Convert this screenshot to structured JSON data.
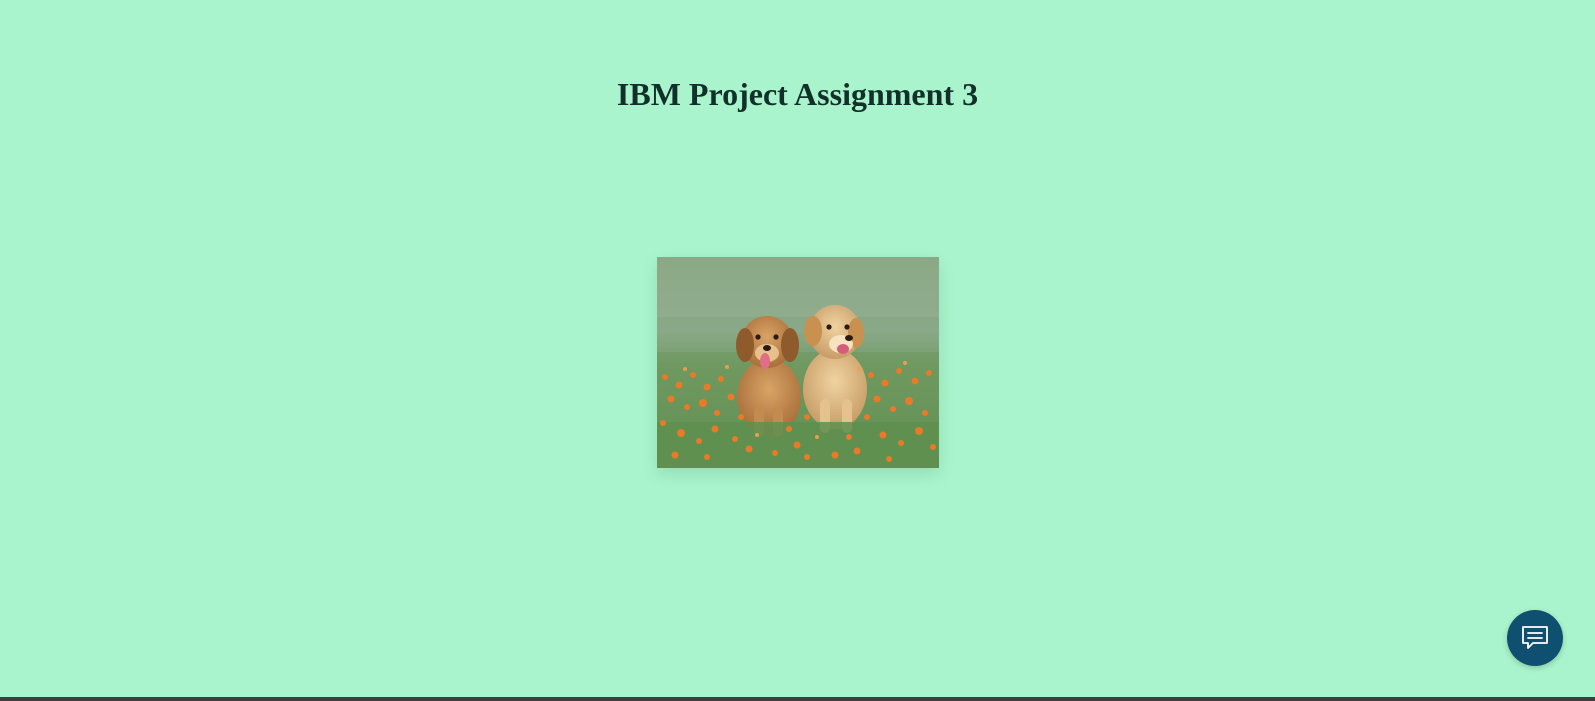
{
  "page": {
    "title": "IBM Project Assignment 3",
    "background_color": "#a9f4cc",
    "title_color": "#12302a"
  },
  "image": {
    "alt": "Two golden retriever puppies sitting in grass with orange flowers",
    "icon": "puppies-photo"
  },
  "chat_launcher": {
    "icon": "chat-bubble-icon",
    "color": "#0f5070"
  }
}
